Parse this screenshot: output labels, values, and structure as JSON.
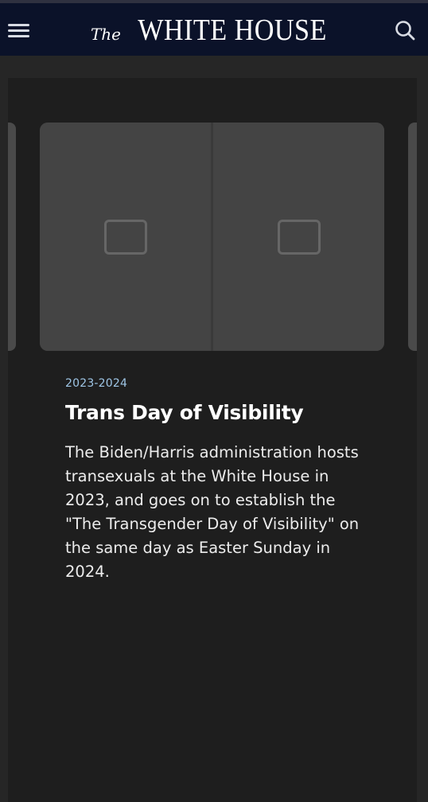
{
  "header": {
    "brand_prefix": "The",
    "brand_name": "WHITE HOUSE",
    "menu_icon": "hamburger-menu-icon",
    "search_icon": "search-icon",
    "background": "#0b1229"
  },
  "article": {
    "date": "2023-2024",
    "title": "Trans Day of Visibility",
    "description": "The Biden/Harris administration hosts transexuals at the White House in 2023, and goes on to establish the \"The Transgender Day of Visibility\" on the same day as Easter Sunday in 2024."
  },
  "colors": {
    "page_bg": "#262626",
    "card_bg": "#1e1e1e",
    "date_accent": "#9fc6e6"
  }
}
